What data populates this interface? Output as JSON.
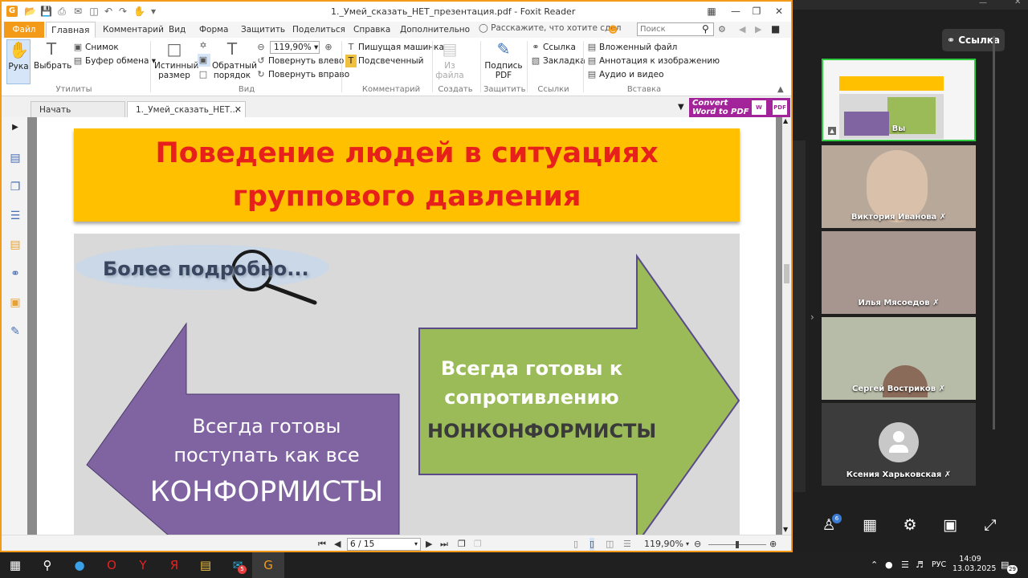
{
  "window": {
    "title": "1._Умей_сказать_НЕТ_презентация.pdf - Foxit Reader"
  },
  "ribbon_tabs": [
    "Файл",
    "Главная",
    "Комментарий",
    "Вид",
    "Форма",
    "Защитить",
    "Поделиться",
    "Справка",
    "Дополнительно"
  ],
  "tell_me": "Расскажите, что хотите сдел",
  "search_placeholder": "Поиск",
  "ribbon": {
    "hand": "Рука",
    "select": "Выбрать",
    "snapshot": "Снимок",
    "clipboard": "Буфер обмена",
    "utilities_group": "Утилиты",
    "actual_size": "Истинный размер",
    "reverse_order": "Обратный порядок",
    "zoom": "119,90%",
    "rotate_left": "Повернуть влево",
    "rotate_right": "Повернуть вправо",
    "view_group": "Вид",
    "typewriter": "Пишущая машинка",
    "highlight": "Подсвеченный",
    "comment_group": "Комментарий",
    "from_file": "Из файла",
    "create_group": "Создать",
    "sign_pdf": "Подпись PDF",
    "protect_group": "Защитить",
    "link": "Ссылка",
    "bookmark": "Закладка",
    "links_group": "Ссылки",
    "attached_file": "Вложенный файл",
    "image_annotation": "Аннотация к изображению",
    "audio_video": "Аудио и видео",
    "insert_group": "Вставка"
  },
  "doc_tabs": {
    "start": "Начать",
    "file": "1._Умей_сказать_НЕТ..."
  },
  "convert_ad": {
    "line1": "Convert",
    "line2": "Word to PDF"
  },
  "slide": {
    "title_line1": "Поведение людей в ситуациях",
    "title_line2": "группового давления",
    "more": "Более подробно...",
    "right_line1": "Всегда готовы к",
    "right_line2": "сопротивлению",
    "right_label": "НОНКОНФОРМИСТЫ",
    "left_line1": "Всегда готовы",
    "left_line2": "поступать как все",
    "left_label": "КОНФОРМИСТЫ",
    "colors": {
      "banner": "#ffc000",
      "title_text": "#e8201c",
      "right_arrow": "#9bbb59",
      "left_arrow": "#8064a2"
    }
  },
  "status": {
    "page": "6 / 15",
    "zoom": "119,90%"
  },
  "conference": {
    "link_button": "Ссылка",
    "self_label": "Вы",
    "participants": [
      "Виктория Иванова",
      "Илья Мясоедов",
      "Сергей Востриков",
      "Ксения Харьковская"
    ],
    "participant_count": "6"
  },
  "taskbar": {
    "lang": "РУС",
    "time": "14:09",
    "date": "13.03.2025",
    "notifications": "29",
    "mail_badge": "5"
  }
}
